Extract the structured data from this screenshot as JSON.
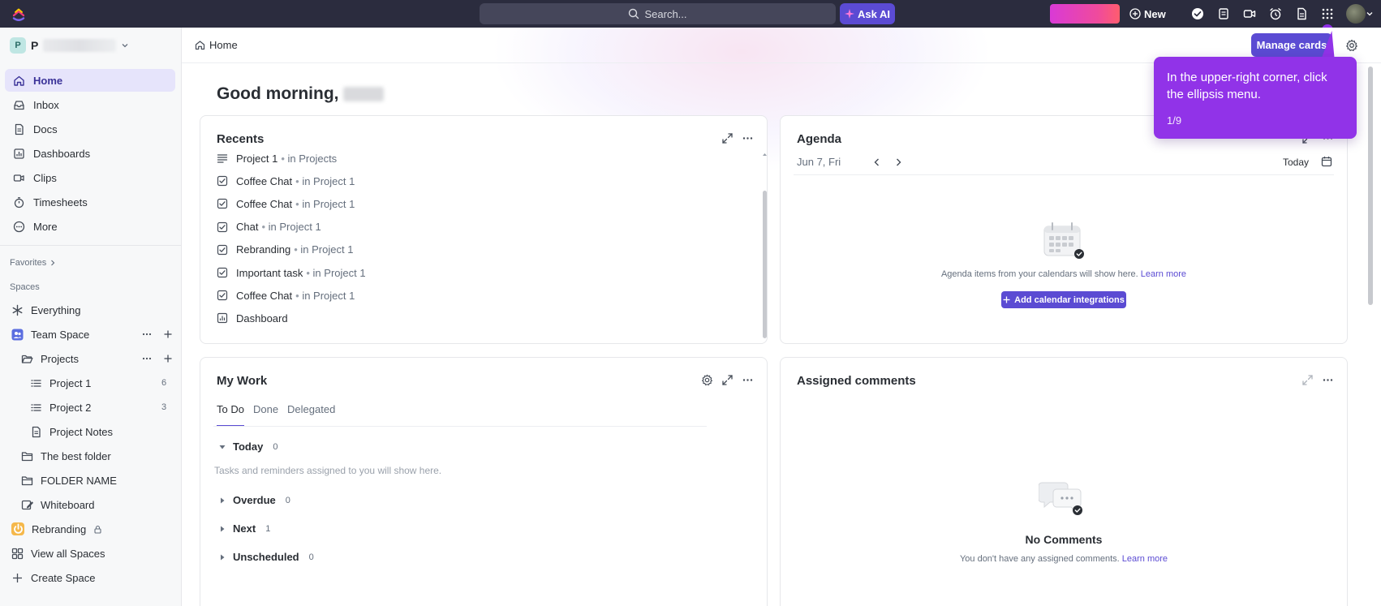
{
  "topbar": {
    "search_placeholder": "Search...",
    "ask_ai": "Ask AI",
    "new_label": "New"
  },
  "workspace": {
    "badge": "P",
    "name": "P"
  },
  "sidebar": {
    "nav": [
      {
        "label": "Home",
        "icon": "home-icon",
        "active": true
      },
      {
        "label": "Inbox",
        "icon": "inbox-icon"
      },
      {
        "label": "Docs",
        "icon": "doc-icon"
      },
      {
        "label": "Dashboards",
        "icon": "dashboard-icon"
      },
      {
        "label": "Clips",
        "icon": "video-icon"
      },
      {
        "label": "Timesheets",
        "icon": "stopwatch-icon"
      },
      {
        "label": "More",
        "icon": "more-icon"
      }
    ],
    "favorites_label": "Favorites",
    "spaces_label": "Spaces",
    "tree": {
      "everything": "Everything",
      "team_space": "Team Space",
      "projects": "Projects",
      "project1": {
        "label": "Project 1",
        "count": "6"
      },
      "project2": {
        "label": "Project 2",
        "count": "3"
      },
      "project_notes": "Project Notes",
      "best_folder": "The best folder",
      "folder_name": "FOLDER NAME",
      "whiteboard": "Whiteboard",
      "rebranding": "Rebranding",
      "view_all": "View all Spaces",
      "create_space": "Create Space"
    }
  },
  "header": {
    "breadcrumb": "Home",
    "manage_cards": "Manage cards"
  },
  "greeting": "Good morning,",
  "recents": {
    "title": "Recents",
    "items": [
      {
        "name": "Project 1",
        "sub": "in Projects",
        "icon": "list-icon"
      },
      {
        "name": "Coffee Chat",
        "sub": "in Project 1",
        "icon": "task-icon"
      },
      {
        "name": "Coffee Chat",
        "sub": "in Project 1",
        "icon": "task-icon"
      },
      {
        "name": "Chat",
        "sub": "in Project 1",
        "icon": "task-icon"
      },
      {
        "name": "Rebranding",
        "sub": "in Project 1",
        "icon": "task-icon"
      },
      {
        "name": "Important task",
        "sub": "in Project 1",
        "icon": "task-icon"
      },
      {
        "name": "Coffee Chat",
        "sub": "in Project 1",
        "icon": "task-icon"
      },
      {
        "name": "Dashboard",
        "sub": "",
        "icon": "dashboard-icon"
      }
    ]
  },
  "agenda": {
    "title": "Agenda",
    "date": "Jun 7, Fri",
    "today": "Today",
    "empty_text": "Agenda items from your calendars will show here.",
    "learn_more": "Learn more",
    "add_button": "Add calendar integrations"
  },
  "mywork": {
    "title": "My Work",
    "tabs": [
      "To Do",
      "Done",
      "Delegated"
    ],
    "groups": [
      {
        "label": "Today",
        "count": "0",
        "open": true
      },
      {
        "label": "Overdue",
        "count": "0"
      },
      {
        "label": "Next",
        "count": "1"
      },
      {
        "label": "Unscheduled",
        "count": "0"
      }
    ],
    "empty_text": "Tasks and reminders assigned to you will show here."
  },
  "comments": {
    "title": "Assigned comments",
    "empty_title": "No Comments",
    "empty_text": "You don't have any assigned comments.",
    "learn_more": "Learn more"
  },
  "tooltip": {
    "text": "In the upper-right corner, click the ellipsis menu.",
    "step": "1/9"
  },
  "colors": {
    "accent": "#5b4bd3",
    "tooltip": "#9133e8",
    "topbar": "#2b2c3e"
  }
}
